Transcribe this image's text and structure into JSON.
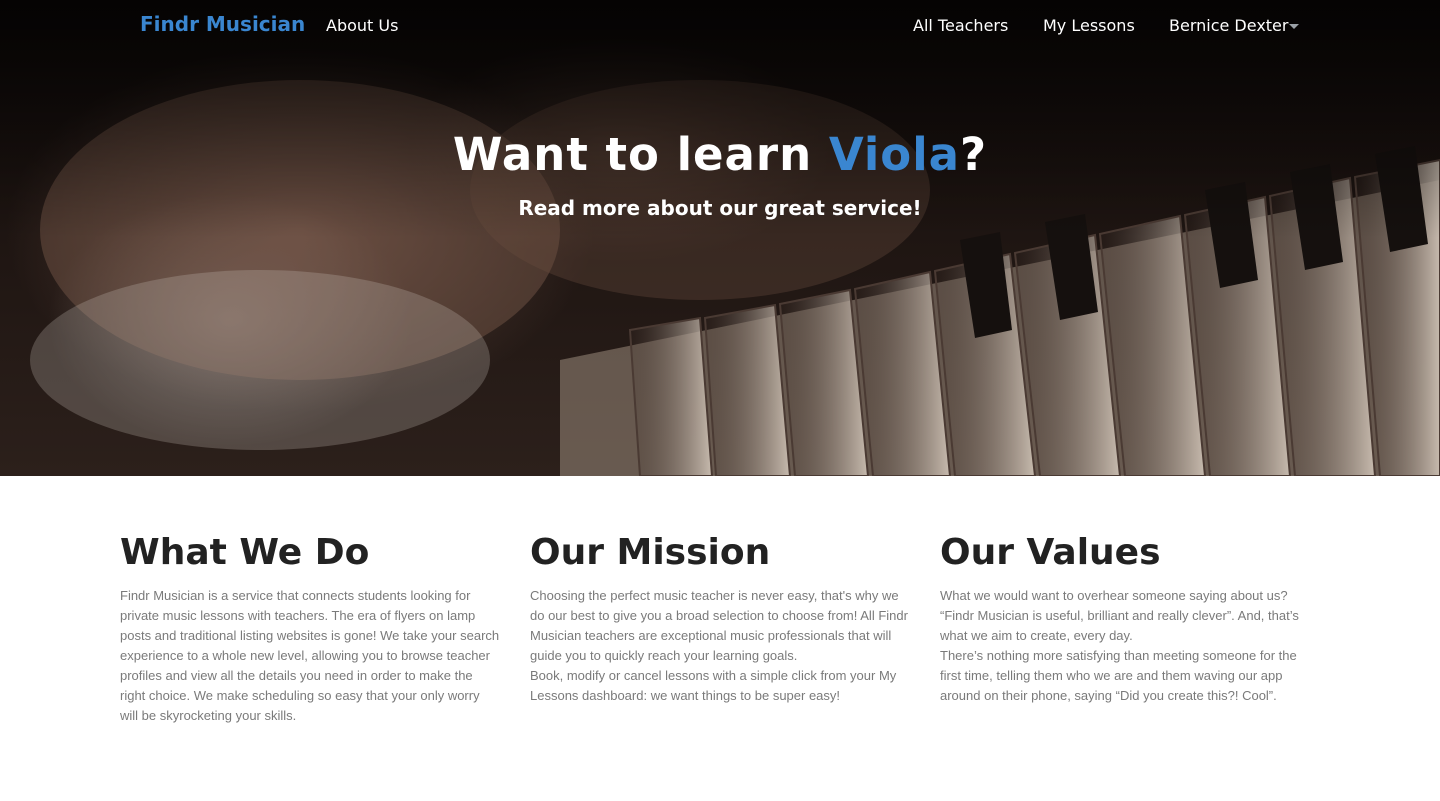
{
  "nav": {
    "brand": "Findr Musician",
    "about": "About Us",
    "teachers": "All Teachers",
    "lessons": "My Lessons",
    "user": "Bernice Dexter",
    "user_icon": "chevron-down-icon"
  },
  "hero": {
    "title_prefix": "Want to learn ",
    "title_accent": "Viola",
    "title_suffix": "?",
    "subtitle": "Read more about our great service!",
    "accent_color": "#3a86d0"
  },
  "sections": {
    "what": {
      "heading": "What We Do",
      "body": "Findr Musician is a service that connects students looking for private music lessons with teachers. The era of flyers on lamp posts and traditional listing websites is gone! We take your search experience to a whole new level, allowing you to browse teacher profiles and view all the details you need in order to make the right choice. We make scheduling so easy that your only worry will be skyrocketing your skills."
    },
    "mission": {
      "heading": "Our Mission",
      "body1": "Choosing the perfect music teacher is never easy, that's why we do our best to give you a broad selection to choose from! All Findr Musician teachers are exceptional music professionals that will guide you to quickly reach your learning goals.",
      "body2": "Book, modify or cancel lessons with a simple click from your My Lessons dashboard: we want things to be super easy!"
    },
    "values": {
      "heading": "Our Values",
      "body1": "What we would want to overhear someone saying about us? “Findr Musician is useful, brilliant and really clever”. And, that’s what we aim to create, every day.",
      "body2": "There’s nothing more satisfying than meeting someone for the first time, telling them who we are and them waving our app around on their phone, saying “Did you create this?! Cool”."
    }
  }
}
